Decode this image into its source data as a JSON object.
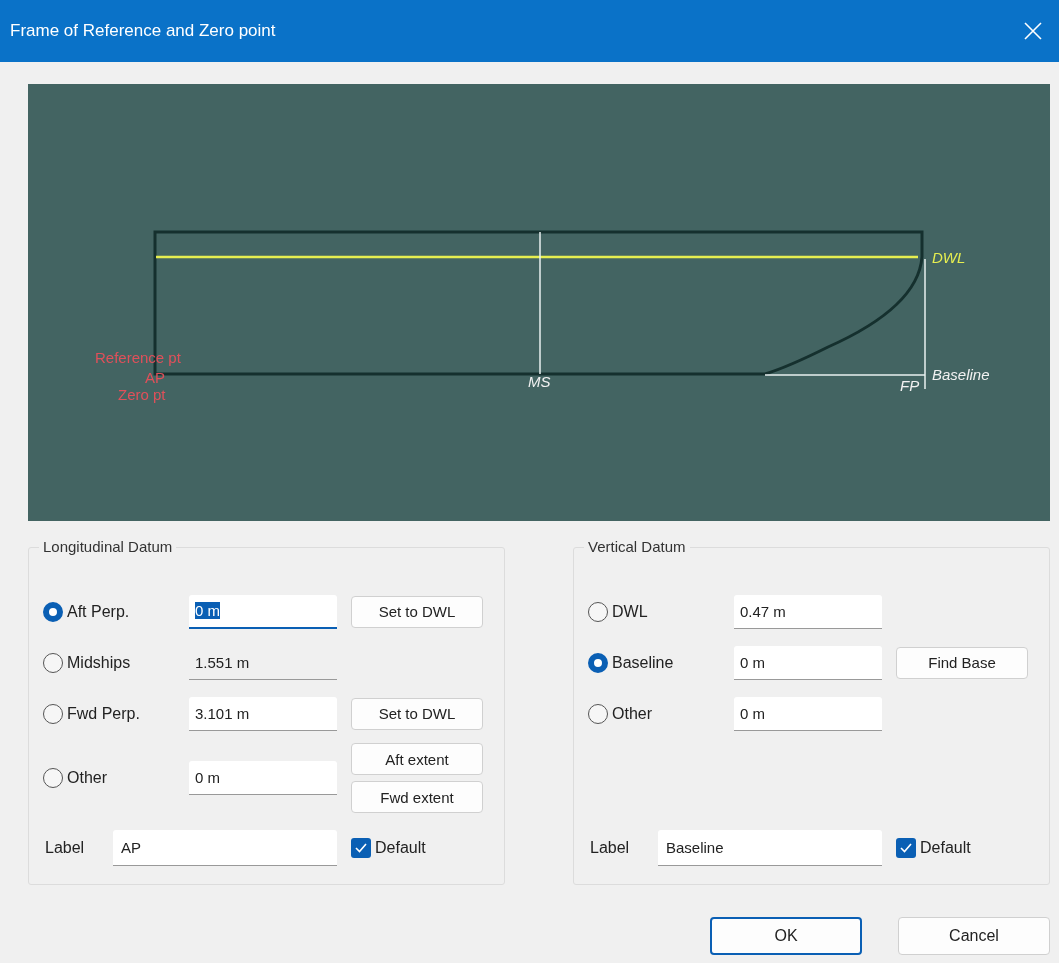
{
  "window": {
    "title": "Frame of Reference and Zero point"
  },
  "preview": {
    "labels": [
      {
        "kind": "reference",
        "text": "Reference pt"
      },
      {
        "kind": "reference",
        "text": "AP"
      },
      {
        "kind": "reference",
        "text": "Zero pt"
      },
      {
        "kind": "station",
        "text": "MS"
      },
      {
        "kind": "station",
        "text": "FP"
      },
      {
        "kind": "waterline",
        "text": "DWL"
      },
      {
        "kind": "station",
        "text": "Baseline"
      }
    ]
  },
  "groups": [
    {
      "title": "Longitudinal Datum",
      "rows": [
        {
          "label": "Aft Perp.",
          "selected": true,
          "value": "0 m",
          "readonly": false,
          "focused": true,
          "buttons": [
            "Set to DWL"
          ]
        },
        {
          "label": "Midships",
          "selected": false,
          "value": "1.551 m",
          "readonly": true,
          "focused": false,
          "buttons": []
        },
        {
          "label": "Fwd Perp.",
          "selected": false,
          "value": "3.101 m",
          "readonly": false,
          "focused": false,
          "buttons": [
            "Set to DWL"
          ]
        },
        {
          "label": "Other",
          "selected": false,
          "value": "0 m",
          "readonly": false,
          "focused": false,
          "buttons": [
            "Aft extent",
            "Fwd extent"
          ]
        }
      ],
      "label_caption": "Label",
      "label_value": "AP",
      "default": {
        "text": "Default",
        "checked": true
      }
    },
    {
      "title": "Vertical Datum",
      "rows": [
        {
          "label": "DWL",
          "selected": false,
          "value": "0.47 m",
          "readonly": false,
          "focused": false,
          "buttons": []
        },
        {
          "label": "Baseline",
          "selected": true,
          "value": "0 m",
          "readonly": false,
          "focused": false,
          "buttons": [
            "Find Base"
          ]
        },
        {
          "label": "Other",
          "selected": false,
          "value": "0 m",
          "readonly": false,
          "focused": false,
          "buttons": []
        }
      ],
      "label_caption": "Label",
      "label_value": "Baseline",
      "default": {
        "text": "Default",
        "checked": true
      }
    }
  ],
  "buttons": [
    {
      "text": "OK",
      "default": true
    },
    {
      "text": "Cancel",
      "default": false
    }
  ]
}
